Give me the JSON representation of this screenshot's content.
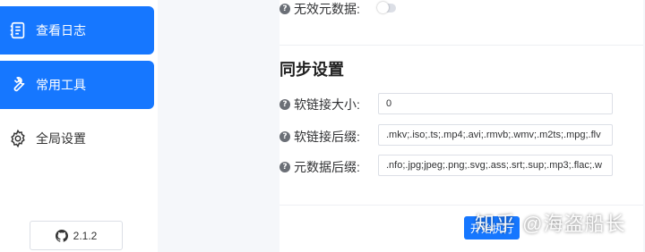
{
  "sidebar": {
    "items": [
      {
        "label": "查看日志",
        "icon": "log-icon"
      },
      {
        "label": "常用工具",
        "icon": "wrench-icon"
      },
      {
        "label": "全局设置",
        "icon": "gear-icon"
      }
    ],
    "version": "2.1.2",
    "version_icon": "github-icon",
    "active_color": "#1677ff"
  },
  "settings": {
    "invalid_metadata_label": "无效元数据:",
    "invalid_metadata_enabled": false,
    "sync_title": "同步设置",
    "softlink_size_label": "软链接大小:",
    "softlink_size_value": "0",
    "softlink_suffix_label": "软链接后缀:",
    "softlink_suffix_value": ".mkv;.iso;.ts;.mp4;.avi;.rmvb;.wmv;.m2ts;.mpg;.flv",
    "metadata_suffix_label": "元数据后缀:",
    "metadata_suffix_value": ".nfo;.jpg;jpeg;.png;.svg;.ass;.srt;.sup;.mp3;.flac;.w",
    "start_button": "开始执行"
  },
  "watermark": "知乎 @海盗船长"
}
